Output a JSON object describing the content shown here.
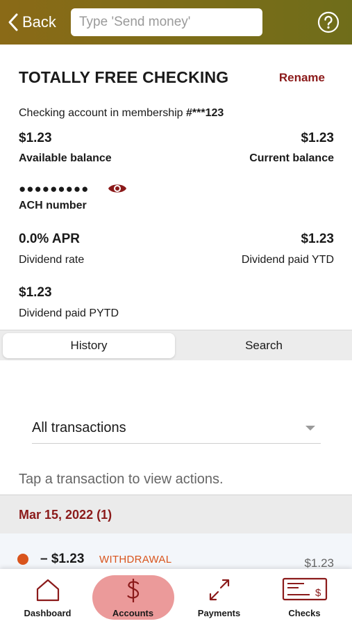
{
  "header": {
    "back_label": "Back",
    "search_placeholder": "Type 'Send money'"
  },
  "account": {
    "title": "TOTALLY FREE CHECKING",
    "rename_label": "Rename",
    "membership_prefix": "Checking account in membership ",
    "membership_number": "#***123",
    "available_value": "$1.23",
    "available_label": "Available balance",
    "current_value": "$1.23",
    "current_label": "Current balance",
    "ach_masked": "●●●●●●●●●",
    "ach_label": "ACH number",
    "dividend_rate_value": "0.0% APR",
    "dividend_rate_label": "Dividend rate",
    "dividend_ytd_value": "$1.23",
    "dividend_ytd_label": "Dividend paid YTD",
    "dividend_pytd_value": "$1.23",
    "dividend_pytd_label": "Dividend paid PYTD"
  },
  "tabs": [
    {
      "label": "History",
      "active": true
    },
    {
      "label": "Search",
      "active": false
    }
  ],
  "filter": {
    "selected": "All transactions"
  },
  "hint": "Tap a transaction to view actions.",
  "date_group": "Mar 15, 2022 (1)",
  "transaction": {
    "amount": "– $1.23",
    "type": "WITHDRAWAL",
    "balance": "$1.23",
    "status_color": "#d9541c"
  },
  "nav": [
    {
      "label": "Dashboard",
      "icon": "home-icon",
      "active": false
    },
    {
      "label": "Accounts",
      "icon": "dollar-icon",
      "active": true
    },
    {
      "label": "Payments",
      "icon": "transfer-arrows-icon",
      "active": false
    },
    {
      "label": "Checks",
      "icon": "check-icon",
      "active": false
    }
  ],
  "colors": {
    "header_gradient_start": "#8a6a17",
    "header_gradient_end": "#6f6d1a",
    "accent": "#8b1a1a",
    "active_nav_highlight": "#eb9a9a"
  }
}
